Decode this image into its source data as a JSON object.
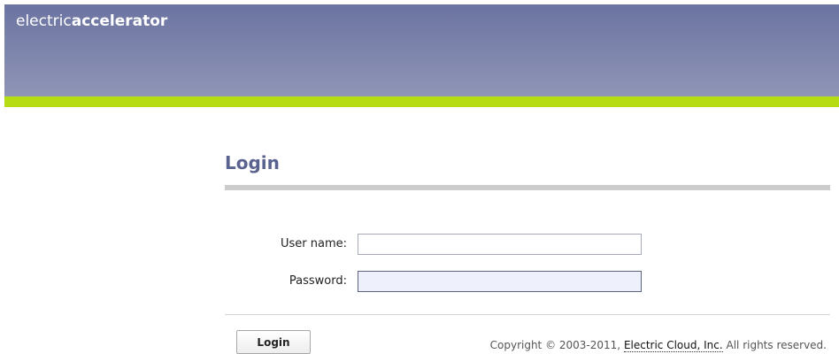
{
  "header": {
    "brand_light": "electric",
    "brand_bold": "accelerator"
  },
  "colors": {
    "header_bg": "#7c83ab",
    "accent_bar": "#b6dc14",
    "title": "#5a6390"
  },
  "login": {
    "title": "Login",
    "username_label": "User name:",
    "username_value": "",
    "password_label": "Password:",
    "password_value": "",
    "submit_label": "Login"
  },
  "footer": {
    "copyright_prefix": "Copyright © 2003-2011, ",
    "company_link": "Electric Cloud, Inc.",
    "copyright_suffix": " All rights reserved."
  }
}
